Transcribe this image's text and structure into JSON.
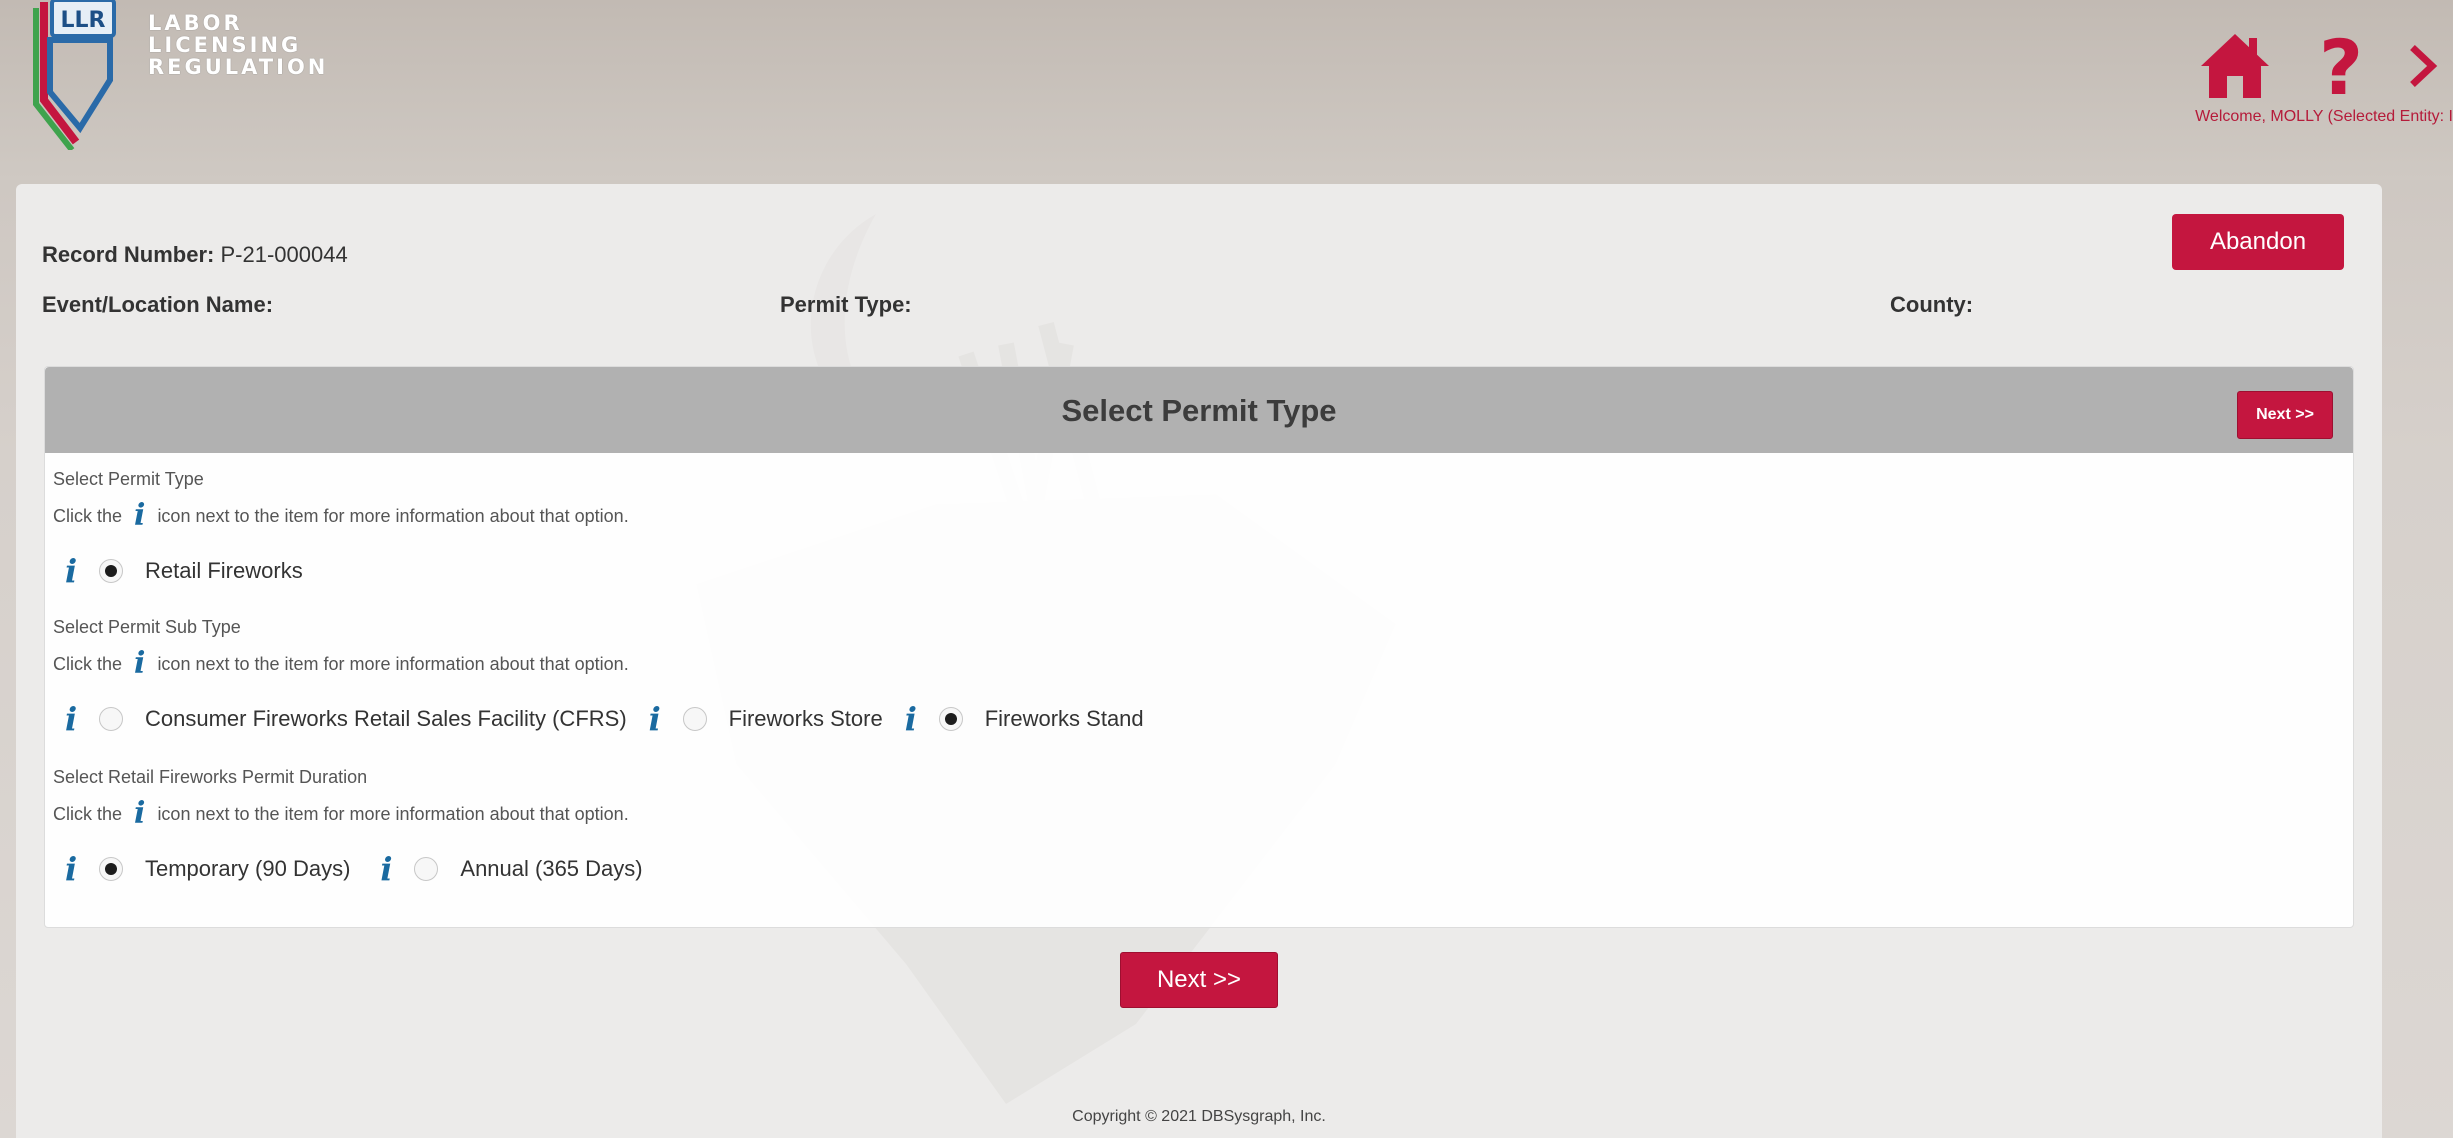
{
  "header": {
    "logo_abbrev": "LLR",
    "logo_lines": [
      "LABOR",
      "LICENSING",
      "REGULATION"
    ],
    "icons": [
      "home-icon",
      "help-icon",
      "logout-icon"
    ],
    "welcome_text": "Welcome, MOLLY (Selected Entity: I"
  },
  "record": {
    "number_label": "Record Number:",
    "number_value": "P-21-000044",
    "event_label": "Event/Location Name:",
    "permit_type_label": "Permit Type:",
    "county_label": "County:",
    "abandon_label": "Abandon"
  },
  "card": {
    "title": "Select Permit Type",
    "next_label": "Next >>",
    "sections": [
      {
        "label": "Select Permit Type",
        "hint_before": "Click the",
        "hint_after": "icon next to the item for more information about that option.",
        "options": [
          {
            "label": "Retail Fireworks",
            "checked": true
          }
        ]
      },
      {
        "label": "Select Permit Sub Type",
        "hint_before": "Click the",
        "hint_after": "icon next to the item for more information about that option.",
        "options": [
          {
            "label": "Consumer Fireworks Retail Sales Facility (CFRS)",
            "checked": false
          },
          {
            "label": "Fireworks Store",
            "checked": false
          },
          {
            "label": "Fireworks Stand",
            "checked": true
          }
        ]
      },
      {
        "label": "Select Retail Fireworks Permit Duration",
        "hint_before": "Click the",
        "hint_after": "icon next to the item for more information about that option.",
        "options": [
          {
            "label": "Temporary (90 Days)",
            "checked": true
          },
          {
            "label": "Annual (365 Days)",
            "checked": false
          }
        ]
      }
    ]
  },
  "footer": {
    "next_label": "Next >>",
    "copyright": "Copyright © 2021 DBSysgraph, Inc."
  },
  "colors": {
    "accent": "#c4163f",
    "info_icon": "#1a6aa0",
    "welcome": "#b51b3a",
    "card_header": "#b1b1b1"
  }
}
